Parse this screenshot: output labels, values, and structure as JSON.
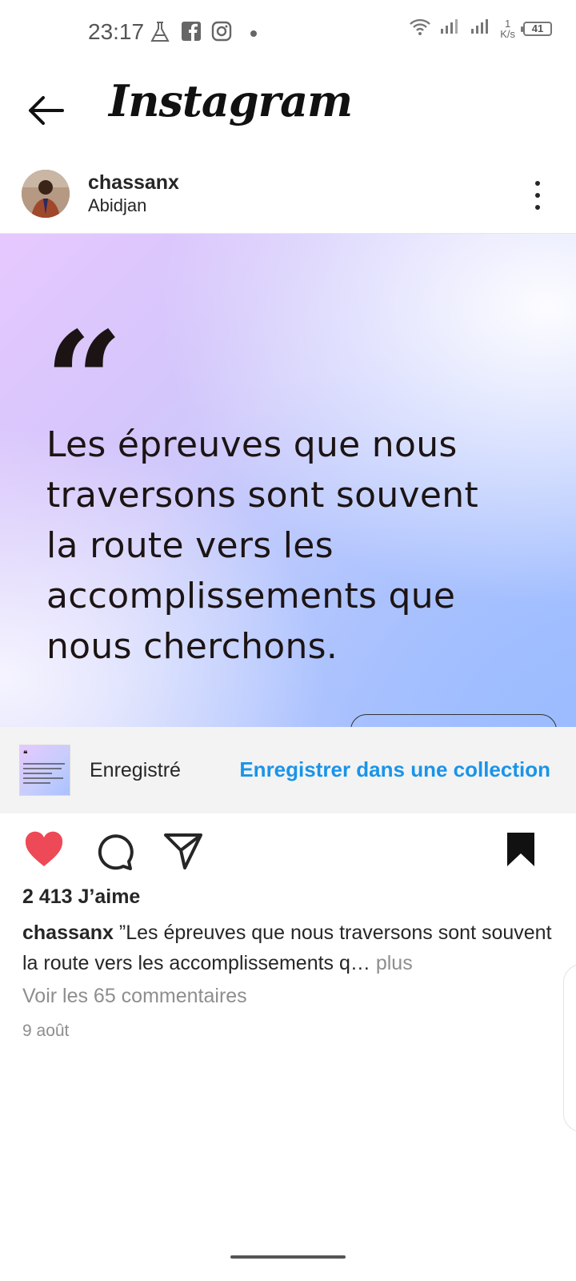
{
  "status_bar": {
    "time": "23:17",
    "net_speed_value": "1",
    "net_speed_unit": "K/s",
    "battery": "41",
    "icons": [
      "flask-icon",
      "facebook-icon",
      "instagram-icon",
      "dot-icon",
      "wifi-icon",
      "signal-icon",
      "signal-icon"
    ]
  },
  "header": {
    "app_title": "Instagram"
  },
  "post": {
    "username": "chassanx",
    "location": "Abidjan",
    "quote_mark": "“",
    "quote_text": "Les épreuves que nous traversons sont souvent la route vers les accomplissements que nous cherchons.",
    "saved_label": "Enregistré",
    "save_collection_label": "Enregistrer dans une collection",
    "likes": "2 413 J’aime",
    "caption_user": "chassanx",
    "caption_text": " ”Les épreuves que nous traversons sont souvent la route vers les accomplissements q…",
    "caption_more": " plus",
    "comments_link": "Voir les 65 commentaires",
    "date": "9 août",
    "liked": true,
    "saved": true
  },
  "colors": {
    "accent_blue": "#1a94e8",
    "like_red": "#ed4956",
    "text_dark": "#262626",
    "text_muted": "#8e8e8e"
  }
}
